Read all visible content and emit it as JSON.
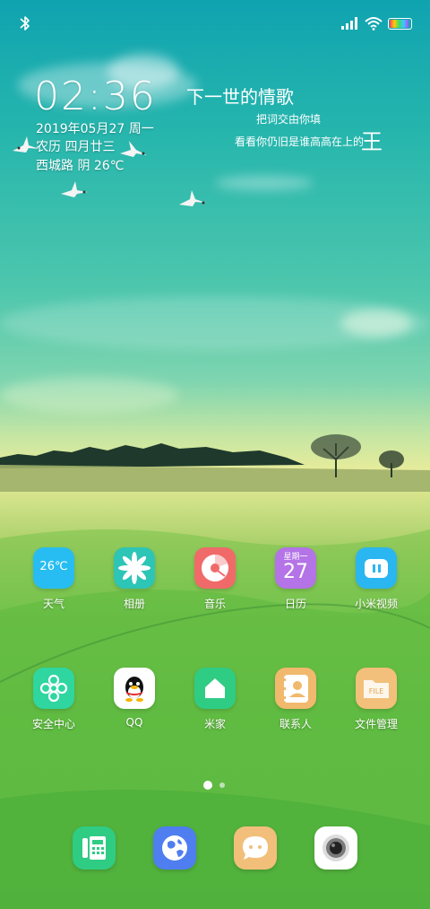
{
  "status_bar": {
    "left_icons": [
      "bluetooth-icon"
    ],
    "right_icons": [
      "signal-icon",
      "wifi-icon",
      "battery-icon"
    ],
    "battery_level": 0.9
  },
  "clock_widget": {
    "time": "02:36",
    "date": "2019年05月27 周一",
    "lunar": "农历 四月廿三",
    "weather": "西城路 阴 26℃"
  },
  "lyrics_widget": {
    "title": "下一世的情歌",
    "line1": "把词交由你填",
    "line2": "看看你仍旧是谁高高在上的",
    "line2_big": "王"
  },
  "apps": [
    {
      "label": "天气",
      "icon_text": "26℃",
      "icon": "weather-icon",
      "color": "#27bdf2"
    },
    {
      "label": "相册",
      "icon": "gallery-icon",
      "color": "#2dc5b6"
    },
    {
      "label": "音乐",
      "icon": "music-icon",
      "color": "#f06a6a"
    },
    {
      "label": "日历",
      "icon_top": "星期一",
      "icon_text": "27",
      "icon": "calendar-icon",
      "color": "#b473e6"
    },
    {
      "label": "小米视频",
      "icon": "video-icon",
      "color": "#2ab6f0"
    },
    {
      "label": "安全中心",
      "icon": "security-icon",
      "color": "#2fd6a0"
    },
    {
      "label": "QQ",
      "icon": "qq-icon",
      "color": "#ffffff"
    },
    {
      "label": "米家",
      "icon": "mijia-icon",
      "color": "#2fcc84"
    },
    {
      "label": "联系人",
      "icon": "contacts-icon",
      "color": "#f1b96d"
    },
    {
      "label": "文件管理",
      "icon_text": "FILE",
      "icon": "files-icon",
      "color": "#f2c07a"
    }
  ],
  "page_indicator": {
    "pages": 2,
    "current": 1
  },
  "dock": [
    {
      "icon": "phone-icon",
      "color": "#2fcc84"
    },
    {
      "icon": "browser-icon",
      "color": "#4f7ef0"
    },
    {
      "icon": "messages-icon",
      "color": "#f1bf7a"
    },
    {
      "icon": "camera-icon",
      "color": "#ffffff"
    }
  ]
}
